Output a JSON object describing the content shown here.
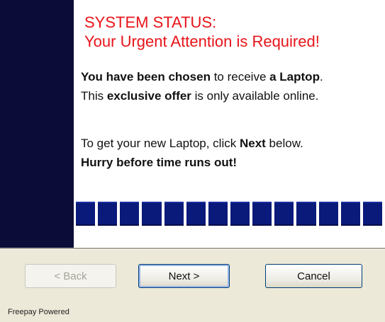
{
  "dialog": {
    "title_line1": "SYSTEM STATUS:",
    "title_line2": "Your Urgent Attention is Required!",
    "para1": {
      "line1_bold1": "You have been chosen",
      "line1_text": " to receive ",
      "line1_bold2": "a Laptop",
      "line1_end": ".",
      "line2_start": "This ",
      "line2_bold": "exclusive offer",
      "line2_end": " is only available online."
    },
    "para2": {
      "line1_start": "To get your new Laptop, click ",
      "line1_bold": "Next",
      "line1_end": " below.",
      "line2_bold": "Hurry before time runs out!"
    },
    "progress": {
      "filled_blocks": 14,
      "total_blocks": 14,
      "color": "#0a1a7a"
    }
  },
  "buttons": {
    "back_label": "< Back",
    "back_enabled": false,
    "next_label": "Next >",
    "cancel_label": "Cancel"
  },
  "footer": {
    "text": "Freepay Powered"
  },
  "colors": {
    "sidebar": "#0c0c38",
    "title": "#e8141a",
    "window_background": "#ece9d8"
  }
}
